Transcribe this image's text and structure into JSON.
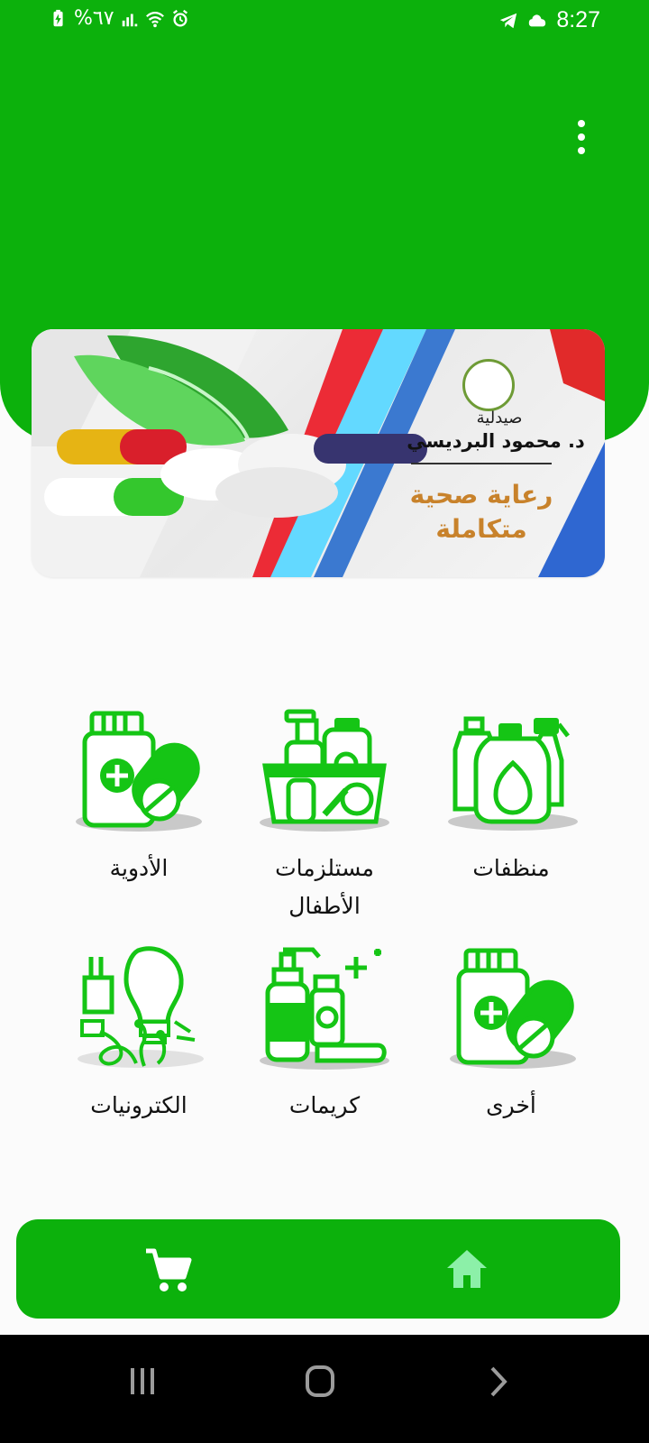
{
  "status_bar": {
    "battery_text": "%٦٧",
    "time": "8:27",
    "icons": [
      "battery-charging-icon",
      "signal-icon",
      "wifi-icon",
      "alarm-icon",
      "telegram-icon",
      "cloud-icon"
    ]
  },
  "header": {
    "menu_icon": "more-vertical-icon"
  },
  "banner": {
    "pharmacy": "صيدلية",
    "doctor": "د. محمود البرديسي",
    "slogan": "رعاية صحية\nمتكاملة"
  },
  "categories": [
    {
      "label": "الأدوية",
      "icon": "medicine-icon"
    },
    {
      "label": "مستلزمات\nالأطفال",
      "icon": "baby-supplies-icon"
    },
    {
      "label": "منظفات",
      "icon": "cleaning-products-icon"
    },
    {
      "label": "الكترونيات",
      "icon": "electronics-icon"
    },
    {
      "label": "كريمات",
      "icon": "creams-icon"
    },
    {
      "label": "أخرى",
      "icon": "other-medicine-icon"
    }
  ],
  "bottom_nav": {
    "items": [
      {
        "icon": "cart-icon"
      },
      {
        "icon": "home-icon"
      }
    ]
  },
  "system_nav": {
    "items": [
      {
        "icon": "recent-apps-icon"
      },
      {
        "icon": "home-system-icon"
      },
      {
        "icon": "back-icon"
      }
    ]
  },
  "colors": {
    "brand_green": "#0cb10c",
    "icon_green": "#15c515",
    "home_active": "#8cf0a8",
    "banner_text_orange": "#c8822b"
  }
}
